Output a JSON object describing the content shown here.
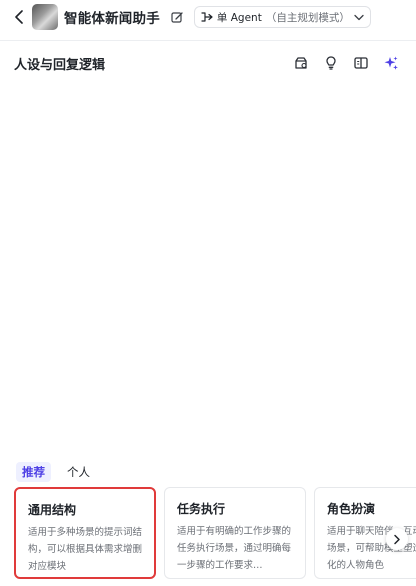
{
  "header": {
    "title": "智能体新闻助手",
    "mode_label": "单 Agent",
    "mode_hint": "（自主规划模式）"
  },
  "section": {
    "title": "人设与回复逻辑"
  },
  "tabs": [
    {
      "label": "推荐",
      "active": true
    },
    {
      "label": "个人",
      "active": false
    }
  ],
  "cards": [
    {
      "title": "通用结构",
      "desc": "适用于多种场景的提示词结构，可以根据具体需求增删对应模块"
    },
    {
      "title": "任务执行",
      "desc": "适用于有明确的工作步骤的任务执行场景，通过明确每一步骤的工作要求…"
    },
    {
      "title": "角色扮演",
      "desc": "适用于聊天陪伴、互动娱乐场景，可帮助模型塑造个性化的人物角色"
    }
  ],
  "colors": {
    "accent": "#4e40e5",
    "selected_border": "#e03a3a"
  }
}
